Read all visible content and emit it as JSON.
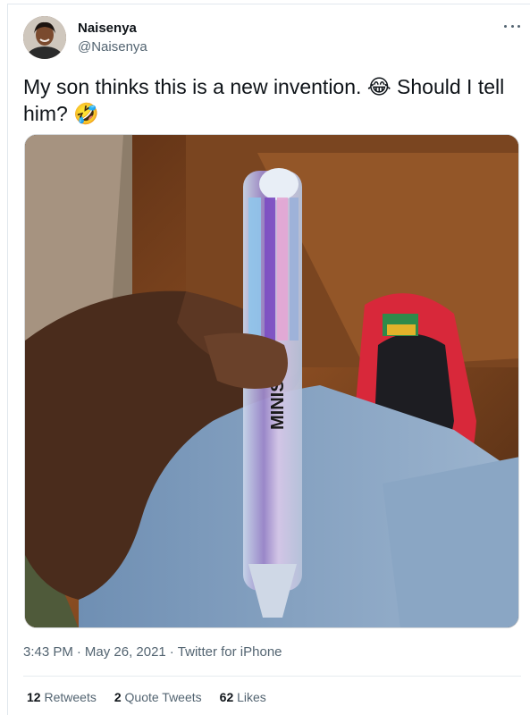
{
  "author": {
    "display_name": "Naisenya",
    "handle": "@Naisenya"
  },
  "tweet": {
    "text": "My son thinks this is a new invention. 😂 Should I tell him? 🤣"
  },
  "media": {
    "description_text": "MINISO"
  },
  "meta": {
    "time": "3:43 PM",
    "sep1": "·",
    "date": "May 26, 2021",
    "sep2": "·",
    "app": "Twitter for iPhone"
  },
  "stats": {
    "retweets_count": "12",
    "retweets_label": "Retweets",
    "quotes_count": "2",
    "quotes_label": "Quote Tweets",
    "likes_count": "62",
    "likes_label": "Likes"
  }
}
